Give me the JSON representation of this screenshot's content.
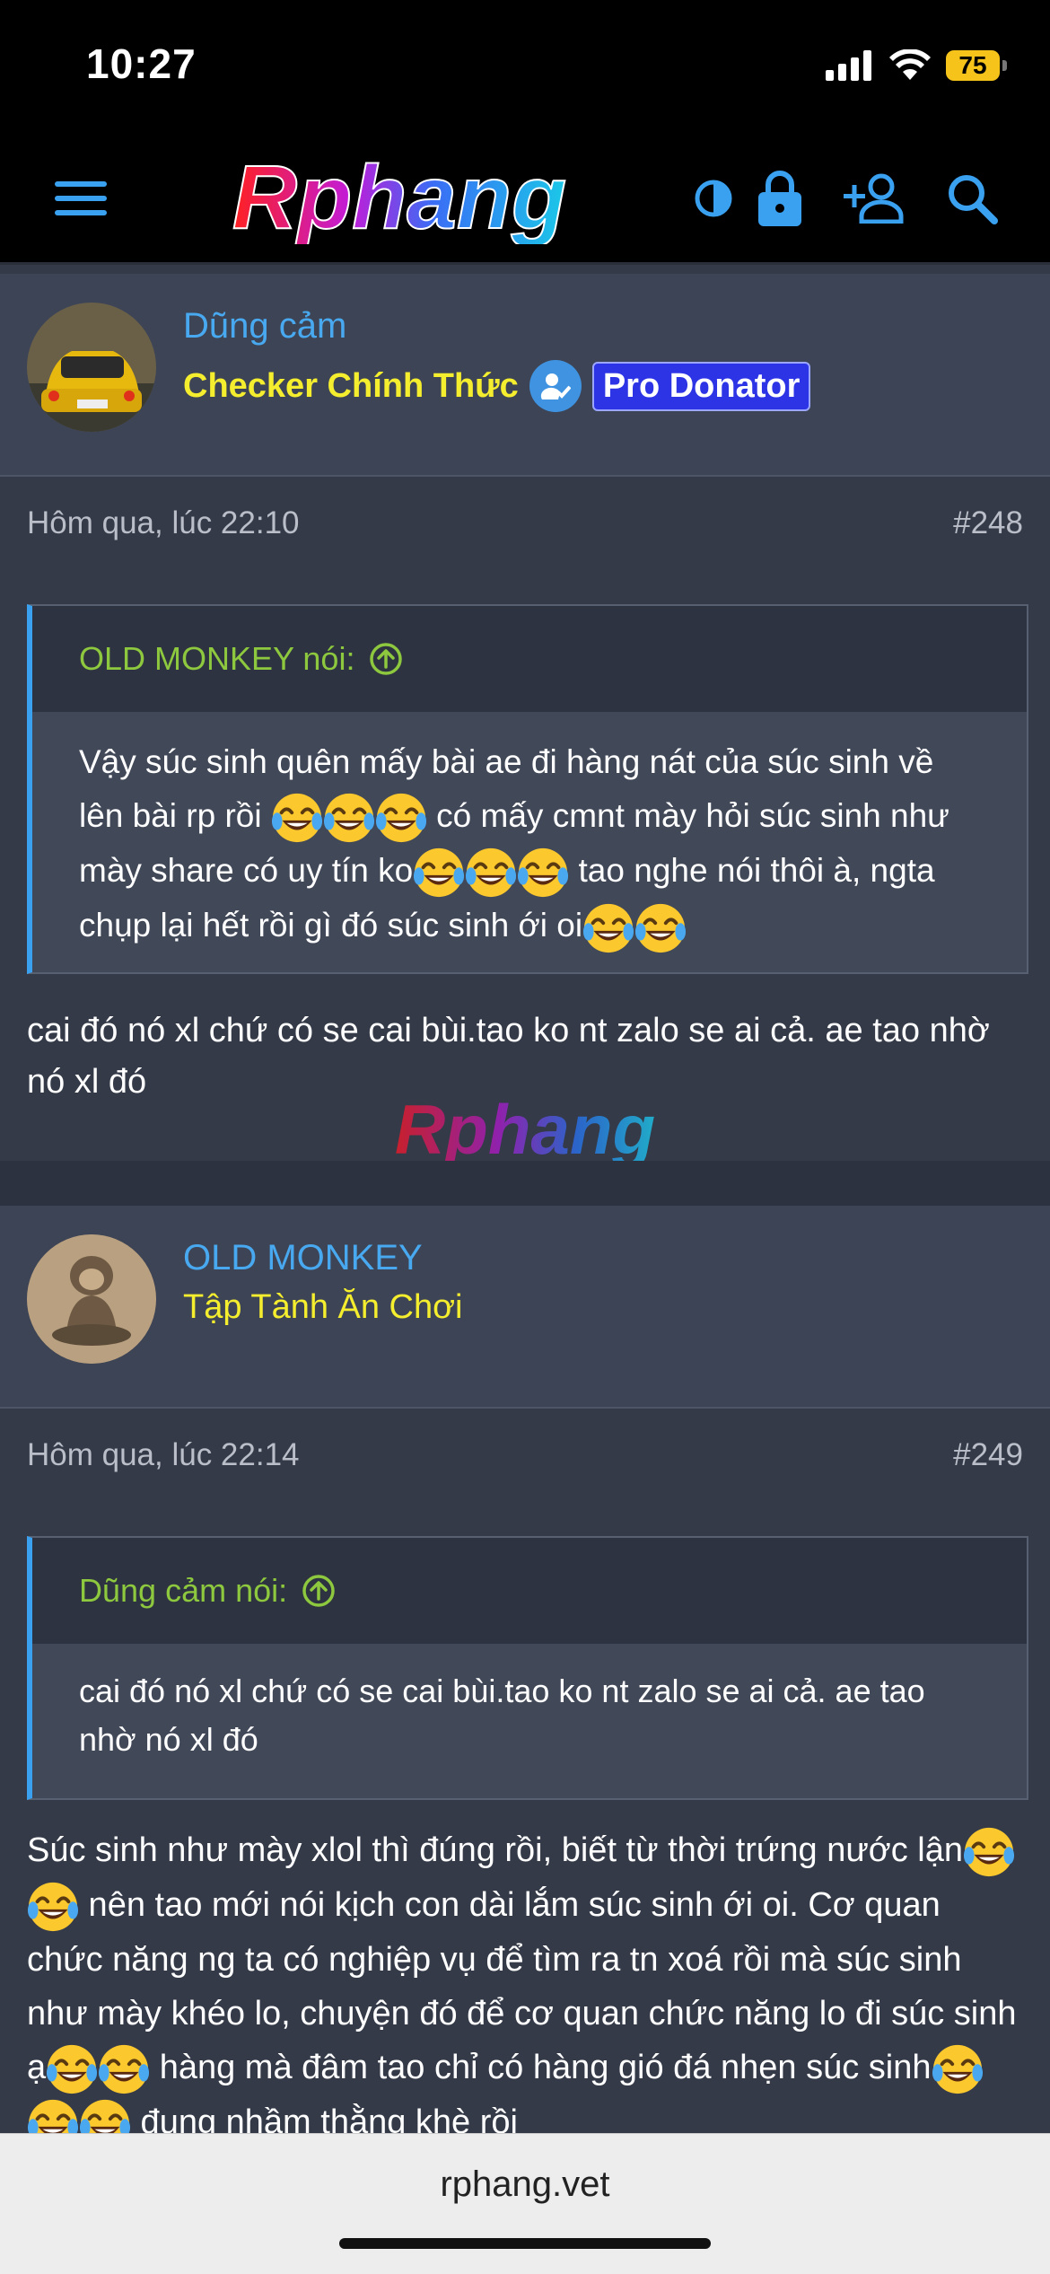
{
  "status_bar": {
    "time": "10:27",
    "battery": "75"
  },
  "nav": {
    "logo_text": "Rphang"
  },
  "posts": [
    {
      "author": "Dũng cảm",
      "title": "Checker Chính Thức",
      "donor_badge": "Pro Donator",
      "timestamp": "Hôm qua, lúc 22:10",
      "number": "#248",
      "quote": {
        "author_line": "OLD MONKEY nói:",
        "segments": [
          "Vậy súc sinh quên mấy bài ae đi hàng nát của súc sinh về lên bài rp rồi ",
          " có mấy cmnt mày hỏi súc sinh như mày share có uy tín ko",
          " tao nghe nói thôi à, ngta chụp lại hết rồi gì đó súc sinh ới oi"
        ]
      },
      "body": "cai đó nó xl chứ có se cai bùi.tao ko nt zalo se ai cả. ae tao nhờ nó xl đó"
    },
    {
      "author": "OLD MONKEY",
      "title": "Tập Tành Ăn Chơi",
      "timestamp": "Hôm qua, lúc 22:14",
      "number": "#249",
      "quote": {
        "author_line": "Dũng cảm nói:",
        "text": "cai đó nó xl chứ có se cai bùi.tao ko nt zalo se ai cả. ae tao nhờ nó xl đó"
      },
      "body_segments": [
        "Súc sinh như mày xlol thì đúng rồi, biết từ thời trứng nước lận",
        " nên tao mới nói kịch con dài lắm súc sinh ới oi. Cơ quan chức năng ng ta có nghiệp vụ để tìm ra tn xoá rồi mà súc sinh như mày khéo lo, chuyện đó để cơ quan chức năng lo đi súc sinh ạ",
        " hàng mà đâm tao chỉ có hàng gió đá nhẹn súc sinh",
        " đụng nhầm thằng khè rồi"
      ]
    }
  ],
  "watermark": "Rphang",
  "browser": {
    "url": "rphang.vet"
  },
  "colors": {
    "accent_blue": "#48a9f0",
    "title_yellow": "#f5ee2f",
    "quote_green": "#8dc83e",
    "pro_badge": "#2c34e6"
  },
  "icons": [
    "menu-icon",
    "contrast-icon",
    "lock-icon",
    "add-user-icon",
    "search-icon",
    "arrow-up-circle-icon",
    "verified-user-icon",
    "laughing-tears-emoji"
  ]
}
